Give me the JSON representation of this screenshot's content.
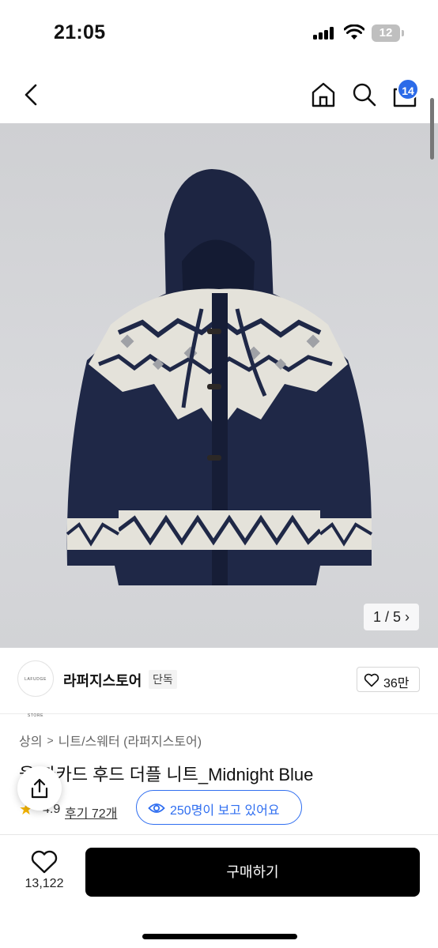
{
  "status": {
    "time": "21:05",
    "battery": "12"
  },
  "nav": {
    "cart_badge": "14"
  },
  "gallery": {
    "counter": "1 / 5",
    "counter_arrow": "›"
  },
  "store": {
    "logo_text": "LAFUDGE STORE",
    "name": "라퍼지스토어",
    "tag": "단독",
    "likes": "36만"
  },
  "breadcrumb": [
    "상의",
    "니트/스웨터 (라퍼지스토어)"
  ],
  "product": {
    "title": "울 자카드 후드 더플 니트_Midnight Blue",
    "rating": "4.9",
    "reviews": "후기 72개",
    "viewing": "250명이 보고 있어요"
  },
  "bottom": {
    "wish_count": "13,122",
    "buy_label": "구매하기"
  },
  "colors": {
    "accent": "#2f6ef0",
    "badge": "#2c6be8",
    "sweater_navy": "#1f2847",
    "sweater_cream": "#e4e2da"
  }
}
